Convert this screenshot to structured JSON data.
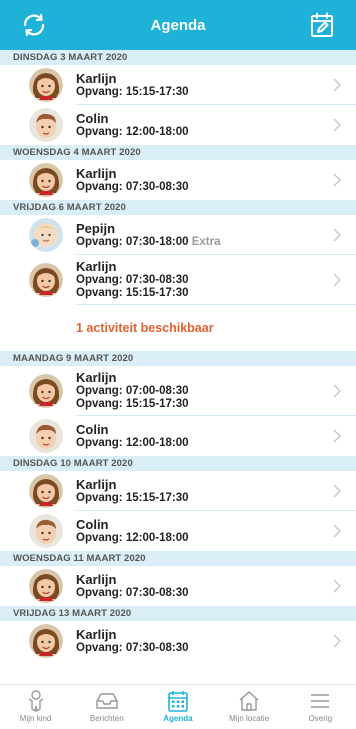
{
  "header": {
    "title": "Agenda",
    "left_icon": "refresh-icon",
    "right_icon": "edit-calendar-icon",
    "brand_color": "#1fb2d8"
  },
  "days": [
    {
      "label": "DINSDAG 3 MAART 2020",
      "entries": [
        {
          "name": "Karlijn",
          "times": [
            "Opvang: 15:15-17:30"
          ],
          "avatar": "girl"
        },
        {
          "name": "Colin",
          "times": [
            "Opvang: 12:00-18:00"
          ],
          "avatar": "boy"
        }
      ]
    },
    {
      "label": "WOENSDAG 4 MAART 2020",
      "entries": [
        {
          "name": "Karlijn",
          "times": [
            "Opvang: 07:30-08:30"
          ],
          "avatar": "girl"
        }
      ]
    },
    {
      "label": "VRIJDAG 6 MAART 2020",
      "entries": [
        {
          "name": "Pepijn",
          "times": [
            "Opvang: 07:30-18:00"
          ],
          "extra": "Extra",
          "avatar": "baby"
        },
        {
          "name": "Karlijn",
          "times": [
            "Opvang: 07:30-08:30",
            "Opvang: 15:15-17:30"
          ],
          "avatar": "girl"
        }
      ],
      "activity": "1 activiteit beschikbaar"
    },
    {
      "label": "MAANDAG 9 MAART 2020",
      "entries": [
        {
          "name": "Karlijn",
          "times": [
            "Opvang: 07:00-08:30",
            "Opvang: 15:15-17:30"
          ],
          "avatar": "girl"
        },
        {
          "name": "Colin",
          "times": [
            "Opvang: 12:00-18:00"
          ],
          "avatar": "boy"
        }
      ]
    },
    {
      "label": "DINSDAG 10 MAART 2020",
      "entries": [
        {
          "name": "Karlijn",
          "times": [
            "Opvang: 15:15-17:30"
          ],
          "avatar": "girl"
        },
        {
          "name": "Colin",
          "times": [
            "Opvang: 12:00-18:00"
          ],
          "avatar": "boy"
        }
      ]
    },
    {
      "label": "WOENSDAG 11 MAART 2020",
      "entries": [
        {
          "name": "Karlijn",
          "times": [
            "Opvang: 07:30-08:30"
          ],
          "avatar": "girl"
        }
      ]
    },
    {
      "label": "VRIJDAG 13 MAART 2020",
      "entries": [
        {
          "name": "Karlijn",
          "times": [
            "Opvang: 07:30-08:30"
          ],
          "avatar": "girl"
        }
      ]
    }
  ],
  "bottom_nav": [
    {
      "label": "Mijn kind",
      "icon": "child-icon",
      "active": false
    },
    {
      "label": "Berichten",
      "icon": "inbox-icon",
      "active": false
    },
    {
      "label": "Agenda",
      "icon": "calendar-icon",
      "active": true
    },
    {
      "label": "Mijn locatie",
      "icon": "home-icon",
      "active": false
    },
    {
      "label": "Overig",
      "icon": "menu-icon",
      "active": false
    }
  ]
}
